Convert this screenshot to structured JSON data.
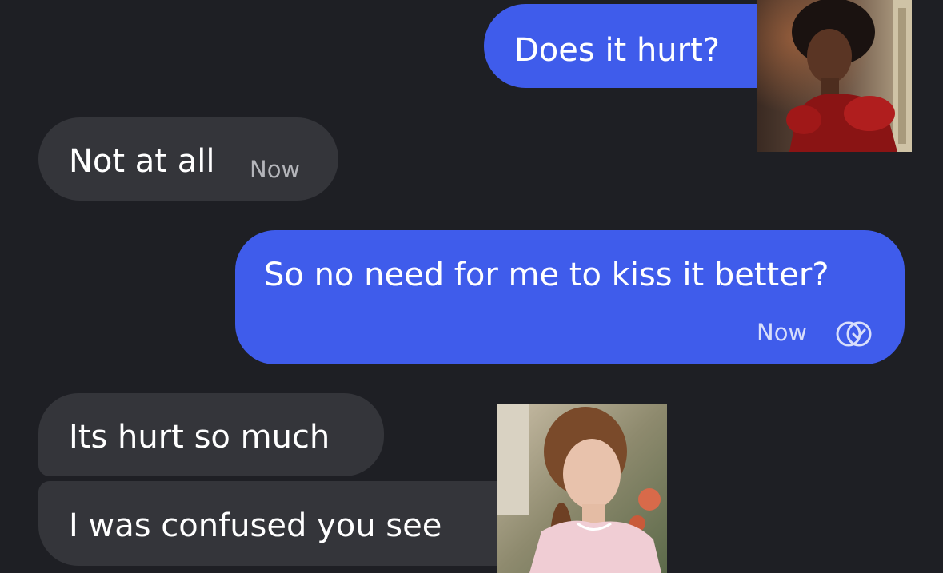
{
  "conversation": {
    "messages": [
      {
        "direction": "sent",
        "text": "Does it hurt?"
      },
      {
        "direction": "received",
        "text": "Not at all",
        "time": "Now"
      },
      {
        "direction": "sent",
        "text": "So no need for me to kiss it better?",
        "time": "Now",
        "status_icon": "read-double-check-icon"
      },
      {
        "direction": "received",
        "text": "Its hurt so much"
      },
      {
        "direction": "received",
        "text": "I was confused you see"
      }
    ]
  },
  "photos": [
    {
      "description_icon": "woman-red-dress-photo"
    },
    {
      "description_icon": "woman-pink-dress-photo"
    }
  ],
  "colors": {
    "background": "#1e1f24",
    "sent_bubble": "#3f5ceb",
    "received_bubble": "#34353a"
  }
}
